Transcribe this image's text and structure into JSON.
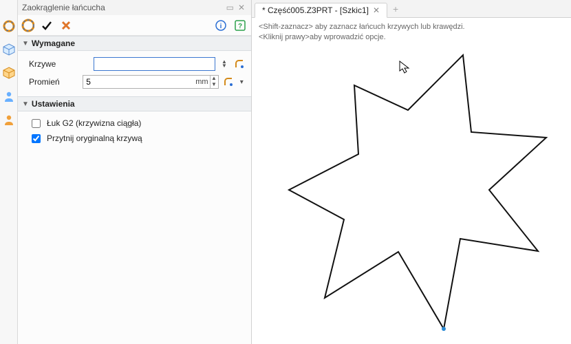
{
  "panel": {
    "title": "Zaokrąglenie łańcucha",
    "sections": {
      "required": "Wymagane",
      "settings": "Ustawienia"
    },
    "fields": {
      "curves_label": "Krzywe",
      "curves_value": "",
      "radius_label": "Promień",
      "radius_value": "5",
      "radius_unit": "mm"
    },
    "checks": {
      "g2_label": "Łuk G2 (krzywizna ciągła)",
      "g2_checked": false,
      "trim_label": "Przytnij oryginalną krzywą",
      "trim_checked": true
    }
  },
  "tab": {
    "label": "* Część005.Z3PRT - [Szkic1]"
  },
  "hints": {
    "line1": "<Shift-zaznacz> aby zaznacz łańcuch krzywych lub krawędzi.",
    "line2": "<Kliknij prawy>aby wprowadzić opcje."
  },
  "icons": {
    "ok": "check",
    "cancel": "x",
    "info": "i",
    "help": "?",
    "chain": "chain-ring"
  }
}
